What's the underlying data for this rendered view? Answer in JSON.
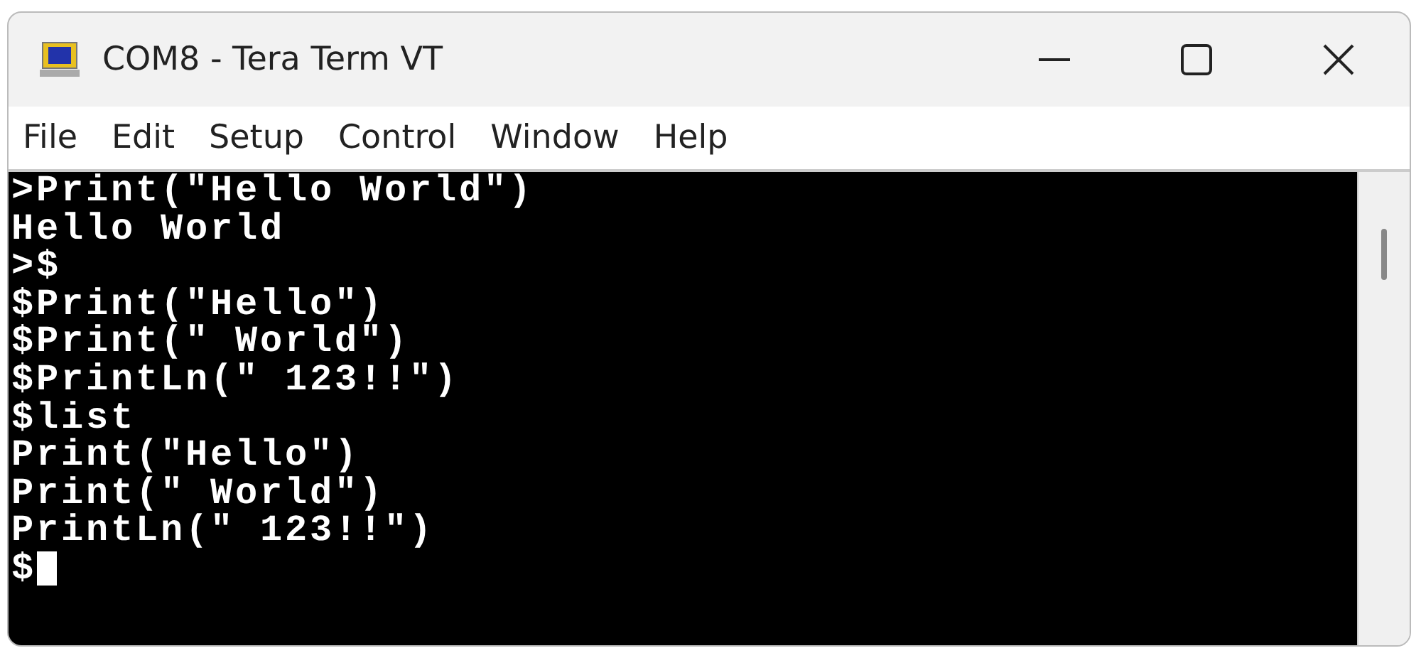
{
  "window": {
    "title": "COM8 - Tera Term VT"
  },
  "menu": [
    "File",
    "Edit",
    "Setup",
    "Control",
    "Window",
    "Help"
  ],
  "terminal": {
    "lines": [
      ">Print(\"Hello World\")",
      "Hello World",
      ">$",
      "$Print(\"Hello\")",
      "$Print(\" World\")",
      "$PrintLn(\" 123!!\")",
      "$list",
      "Print(\"Hello\")",
      "Print(\" World\")",
      "PrintLn(\" 123!!\")",
      "$"
    ],
    "cursor_visible": true
  }
}
